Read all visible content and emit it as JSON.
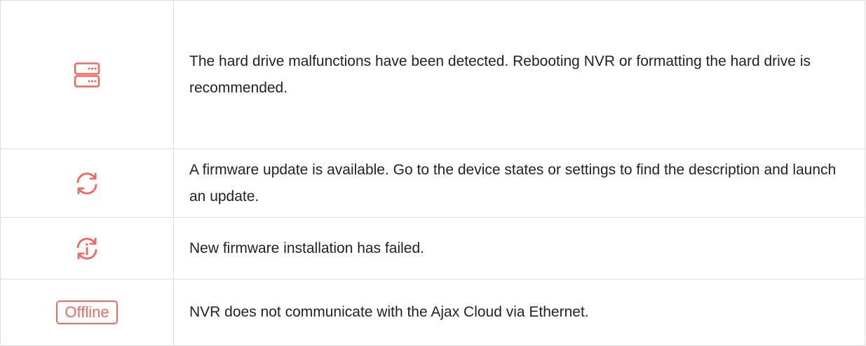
{
  "accent_color": "#ee6a5e",
  "rows": [
    {
      "icon": "hard-drive-icon",
      "text": "The hard drive malfunctions have been detected. Rebooting NVR or formatting the hard drive is recommended."
    },
    {
      "icon": "refresh-icon",
      "text": "A firmware update is available. Go to the device states or settings to find the description and launch an update."
    },
    {
      "icon": "update-failed-icon",
      "text": "New firmware installation has failed."
    },
    {
      "icon": "offline-badge",
      "badge_label": "Offline",
      "text": "NVR does not communicate with the Ajax Cloud via Ethernet."
    }
  ]
}
